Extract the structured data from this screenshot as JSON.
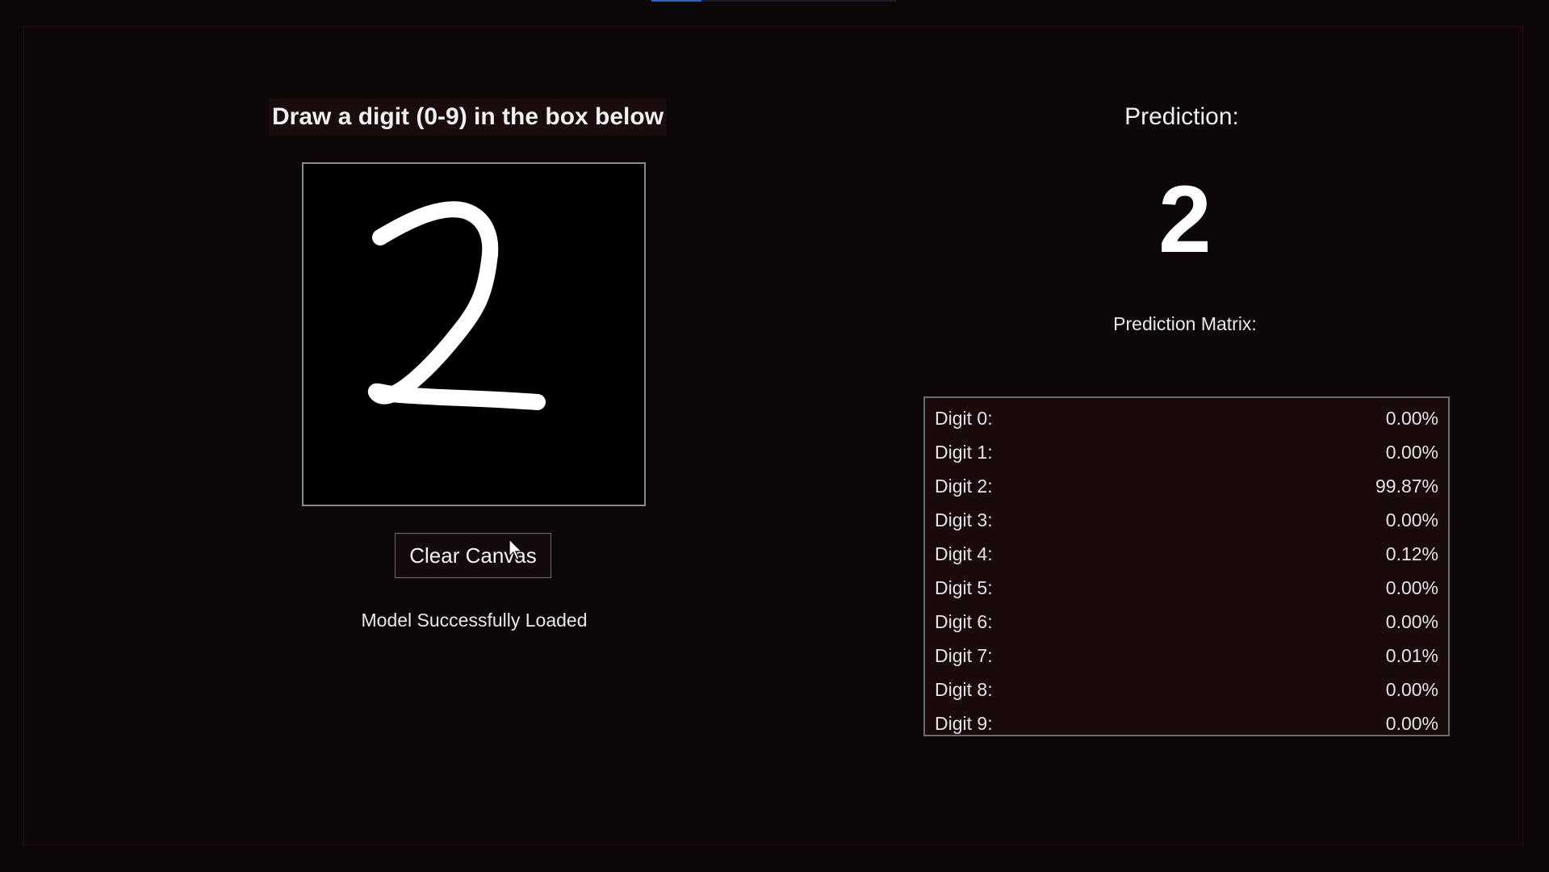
{
  "instruction": "Draw a digit (0-9) in the box below",
  "canvas": {
    "drawn_digit_description": "handwritten 2"
  },
  "clear_button_label": "Clear Canvas",
  "status": "Model Successfully Loaded",
  "prediction": {
    "label": "Prediction:",
    "value": "2",
    "matrix_label": "Prediction Matrix:",
    "rows": [
      {
        "label": "Digit 0:",
        "value": "0.00%"
      },
      {
        "label": "Digit 1:",
        "value": "0.00%"
      },
      {
        "label": "Digit 2:",
        "value": "99.87%"
      },
      {
        "label": "Digit 3:",
        "value": "0.00%"
      },
      {
        "label": "Digit 4:",
        "value": "0.12%"
      },
      {
        "label": "Digit 5:",
        "value": "0.00%"
      },
      {
        "label": "Digit 6:",
        "value": "0.00%"
      },
      {
        "label": "Digit 7:",
        "value": "0.01%"
      },
      {
        "label": "Digit 8:",
        "value": "0.00%"
      },
      {
        "label": "Digit 9:",
        "value": "0.00%"
      }
    ]
  },
  "colors": {
    "background": "#0e0707",
    "canvas_background": "#000000",
    "stroke": "#ffffff",
    "matrix_background": "#1a0a0c",
    "top_indicator": "#2a62c8"
  },
  "icons": {
    "cursor": "mouse-pointer-icon"
  }
}
